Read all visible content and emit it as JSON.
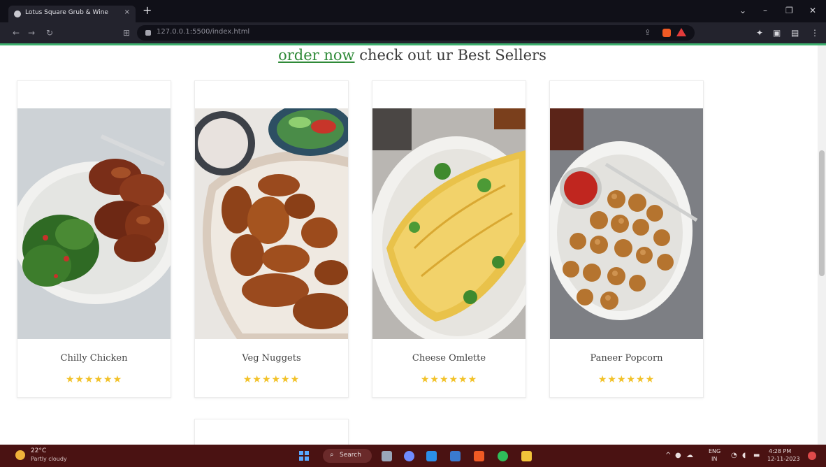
{
  "browser": {
    "tab_title": "Lotus Square Grub & Wine",
    "tab_close": "×",
    "new_tab": "+",
    "url": "127.0.0.1:5500/index.html",
    "window_controls": [
      "⌄",
      "–",
      "❐",
      "✕"
    ],
    "nav_icons": [
      "←",
      "→",
      "↻",
      "⊞"
    ]
  },
  "page": {
    "heading_link": "order now",
    "heading_rest": " check out ur Best Sellers",
    "accent_color": "#2f8a38",
    "star_color": "#f2c229",
    "products": [
      {
        "name": "Chilly Chicken",
        "stars": "★★★★★★",
        "rating": 6,
        "dish_icon": "chicken-dish"
      },
      {
        "name": "Veg Nuggets",
        "stars": "★★★★★★",
        "rating": 6,
        "dish_icon": "nuggets-dish"
      },
      {
        "name": "Cheese Omlette",
        "stars": "★★★★★★",
        "rating": 6,
        "dish_icon": "omelette-dish"
      },
      {
        "name": "Paneer Popcorn",
        "stars": "★★★★★★",
        "rating": 6,
        "dish_icon": "popcorn-dish"
      }
    ]
  },
  "taskbar": {
    "weather_temp": "22°C",
    "weather_desc": "Partly cloudy",
    "search_label": "Search",
    "tray_lang": "ENG",
    "tray_region": "IN",
    "time": "4:28 PM",
    "date": "12-11-2023",
    "background": "#4a1212"
  }
}
